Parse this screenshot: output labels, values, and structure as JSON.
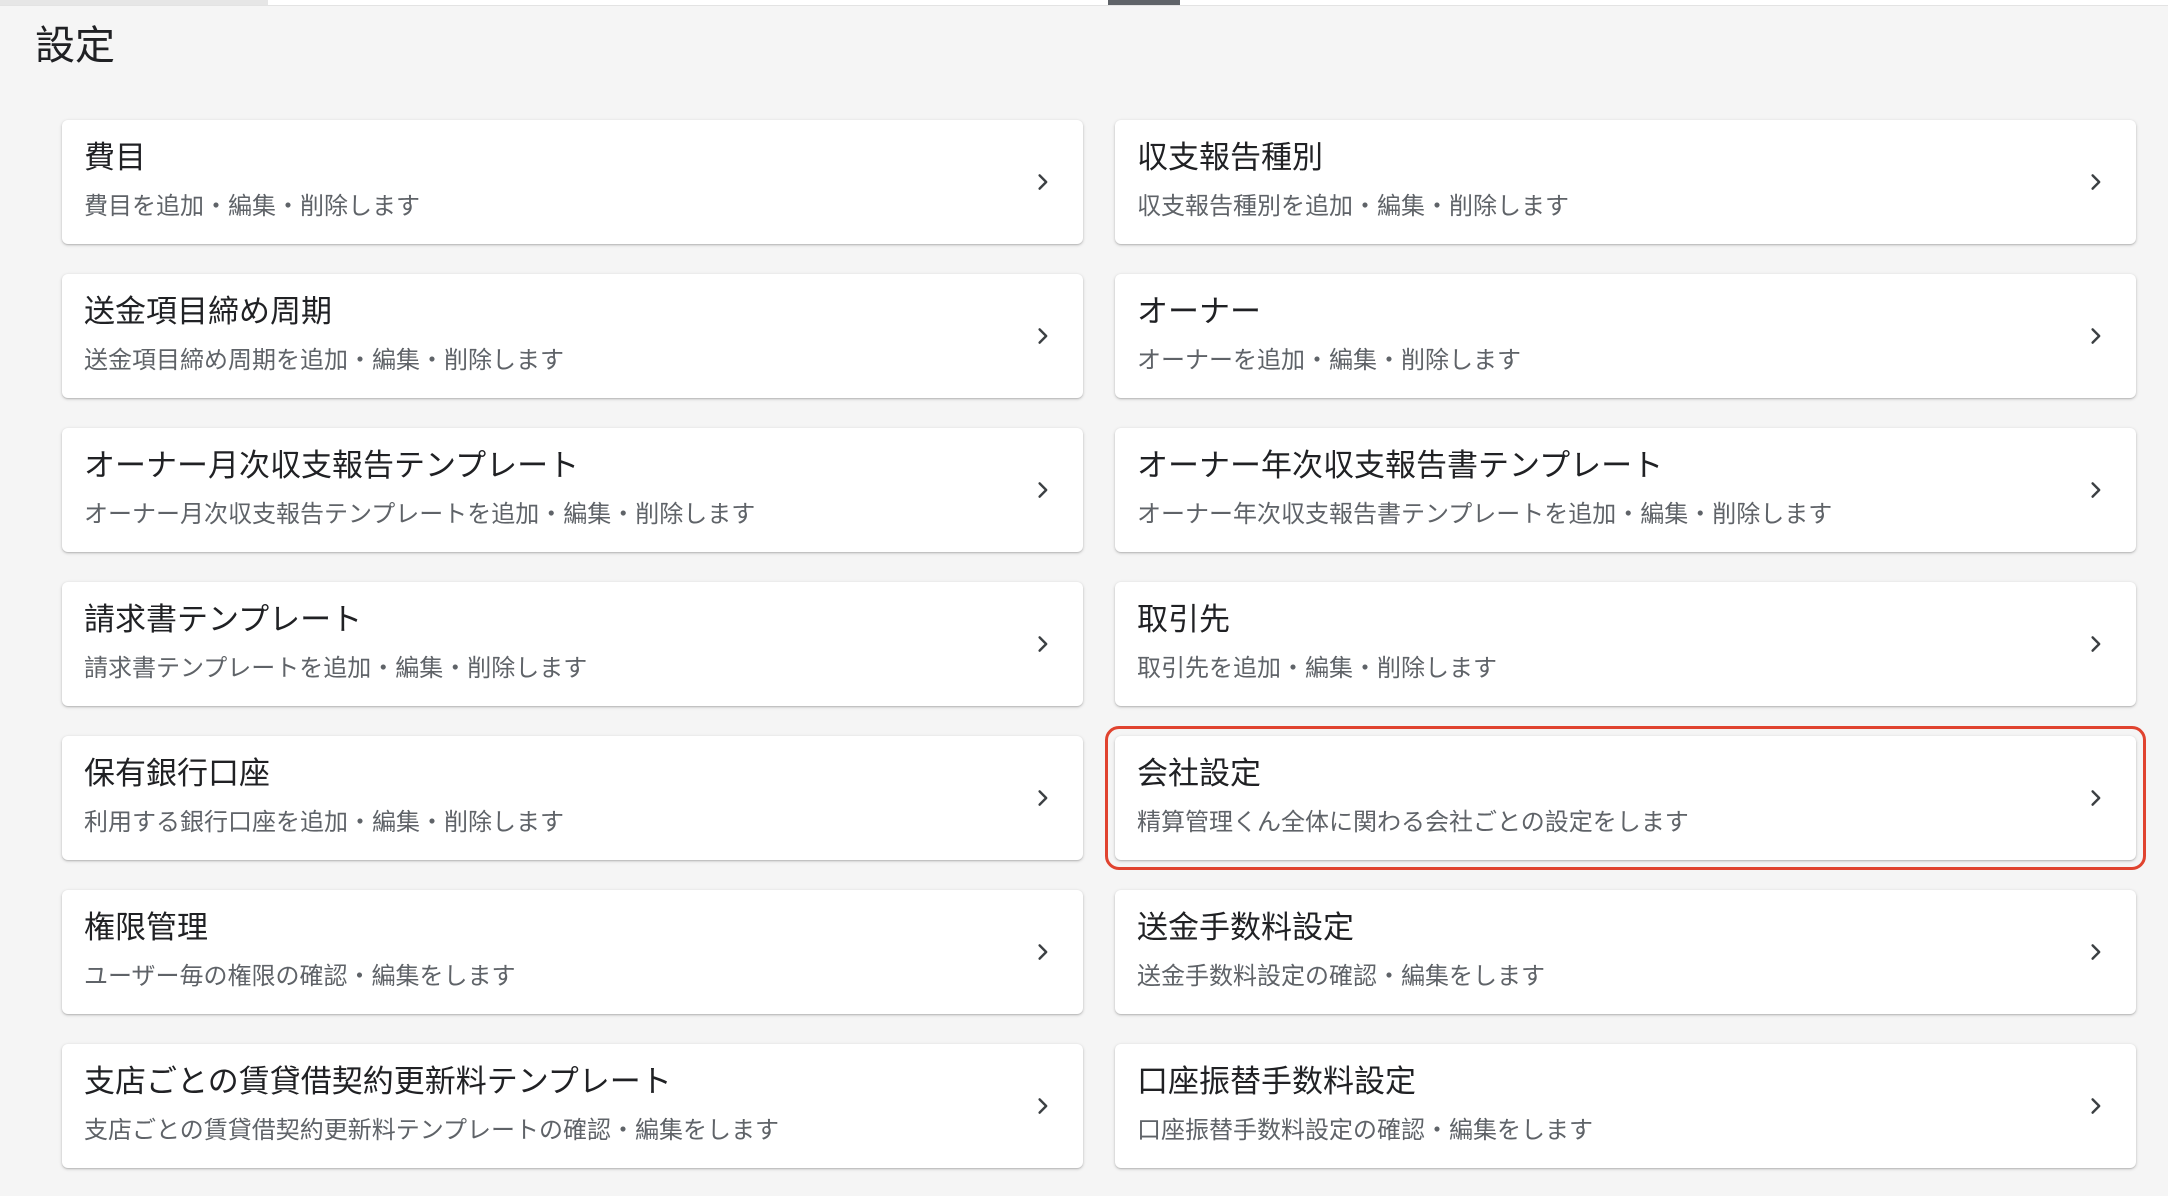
{
  "page": {
    "title": "設定"
  },
  "settings": [
    {
      "title": "費目",
      "description": "費目を追加・編集・削除します",
      "highlighted": false
    },
    {
      "title": "収支報告種別",
      "description": "収支報告種別を追加・編集・削除します",
      "highlighted": false
    },
    {
      "title": "送金項目締め周期",
      "description": "送金項目締め周期を追加・編集・削除します",
      "highlighted": false
    },
    {
      "title": "オーナー",
      "description": "オーナーを追加・編集・削除します",
      "highlighted": false
    },
    {
      "title": "オーナー月次収支報告テンプレート",
      "description": "オーナー月次収支報告テンプレートを追加・編集・削除します",
      "highlighted": false
    },
    {
      "title": "オーナー年次収支報告書テンプレート",
      "description": "オーナー年次収支報告書テンプレートを追加・編集・削除します",
      "highlighted": false
    },
    {
      "title": "請求書テンプレート",
      "description": "請求書テンプレートを追加・編集・削除します",
      "highlighted": false
    },
    {
      "title": "取引先",
      "description": "取引先を追加・編集・削除します",
      "highlighted": false
    },
    {
      "title": "保有銀行口座",
      "description": "利用する銀行口座を追加・編集・削除します",
      "highlighted": false
    },
    {
      "title": "会社設定",
      "description": "精算管理くん全体に関わる会社ごとの設定をします",
      "highlighted": true
    },
    {
      "title": "権限管理",
      "description": "ユーザー毎の権限の確認・編集をします",
      "highlighted": false
    },
    {
      "title": "送金手数料設定",
      "description": "送金手数料設定の確認・編集をします",
      "highlighted": false
    },
    {
      "title": "支店ごとの賃貸借契約更新料テンプレート",
      "description": "支店ごとの賃貸借契約更新料テンプレートの確認・編集をします",
      "highlighted": false
    },
    {
      "title": "口座振替手数料設定",
      "description": "口座振替手数料設定の確認・編集をします",
      "highlighted": false
    }
  ],
  "icons": {
    "card_arrow": "chevron-right-icon"
  },
  "colors": {
    "highlight_border": "#e0432f",
    "background": "#f5f5f5",
    "card": "#ffffff",
    "title_text": "#202124",
    "description_text": "#5f6368"
  }
}
